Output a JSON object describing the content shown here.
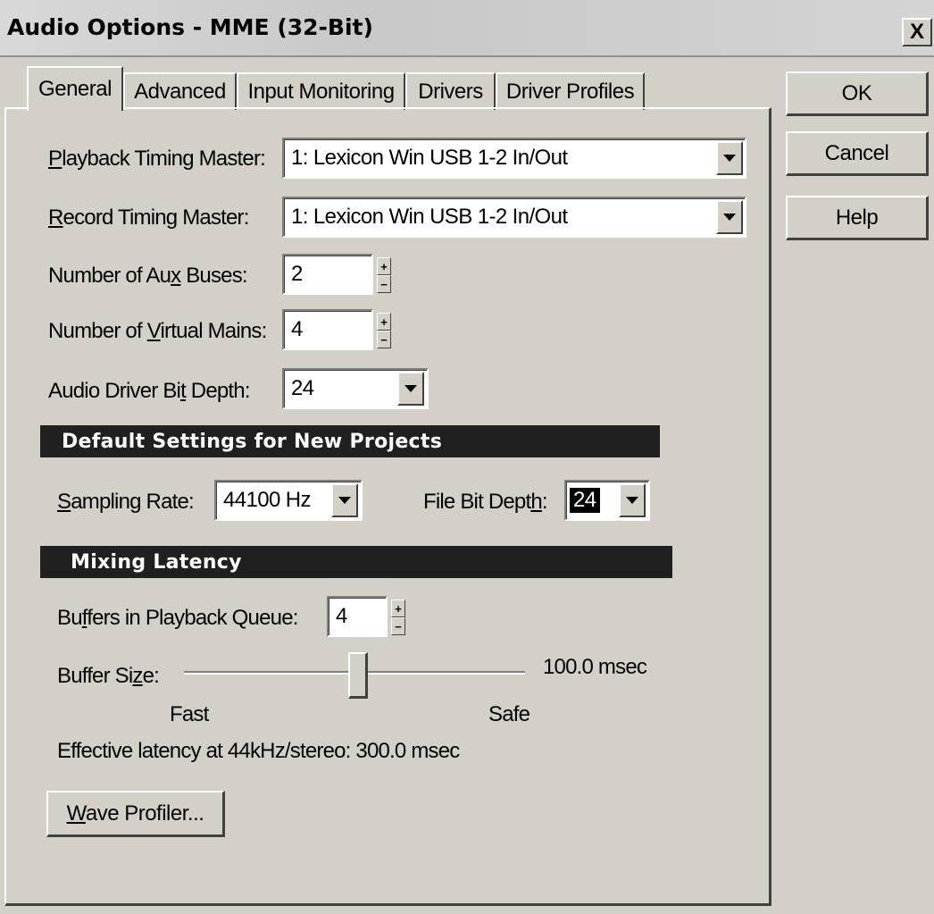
{
  "window": {
    "title": "Audio Options - MME (32-Bit)",
    "close_glyph": "X"
  },
  "tabs": [
    {
      "label": "General",
      "active": true
    },
    {
      "label": "Advanced",
      "active": false
    },
    {
      "label": "Input Monitoring",
      "active": false
    },
    {
      "label": "Drivers",
      "active": false
    },
    {
      "label": "Driver Profiles",
      "active": false
    }
  ],
  "buttons": {
    "ok": "OK",
    "cancel": "Cancel",
    "help": "Help",
    "wave_profiler": "Wave Profiler..."
  },
  "general": {
    "playback_master": {
      "label_pre": "",
      "label_u": "P",
      "label_post": "layback Timing Master:",
      "value": "1: Lexicon Win USB 1-2 In/Out"
    },
    "record_master": {
      "label_pre": "",
      "label_u": "R",
      "label_post": "ecord Timing Master:",
      "value": "1: Lexicon Win USB 1-2 In/Out"
    },
    "aux_buses": {
      "label_pre": "Number of Au",
      "label_u": "x",
      "label_post": " Buses:",
      "value": "2"
    },
    "virtual_mains": {
      "label_pre": "Number of ",
      "label_u": "V",
      "label_post": "irtual Mains:",
      "value": "4"
    },
    "bit_depth": {
      "label_pre": "Audio Driver Bi",
      "label_u": "t",
      "label_post": " Depth:",
      "value": "24"
    }
  },
  "defaults": {
    "header": "Default Settings for New Projects",
    "sampling_rate": {
      "label_pre": "",
      "label_u": "S",
      "label_post": "ampling Rate:",
      "value": "44100 Hz"
    },
    "file_bit_depth": {
      "label_pre": "File Bit Dept",
      "label_u": "h",
      "label_post": ":",
      "value": "24"
    }
  },
  "latency": {
    "header": "Mixing Latency",
    "buffers": {
      "label_pre": "Bu",
      "label_u": "f",
      "label_post": "fers in Playback Queue:",
      "value": "4"
    },
    "buffer_size": {
      "label_pre": "Buffer Si",
      "label_u": "z",
      "label_post": "e:",
      "value_text": "100.0 msec",
      "slider_fraction": 0.51
    },
    "fast_label": "Fast",
    "safe_label": "Safe",
    "effective": "Effective latency at 44kHz/stereo:  300.0 msec"
  },
  "wave_profiler": {
    "label_pre": "",
    "label_u": "W",
    "label_post": "ave Profiler..."
  },
  "spin_glyphs": {
    "up": "+",
    "down": "−"
  }
}
